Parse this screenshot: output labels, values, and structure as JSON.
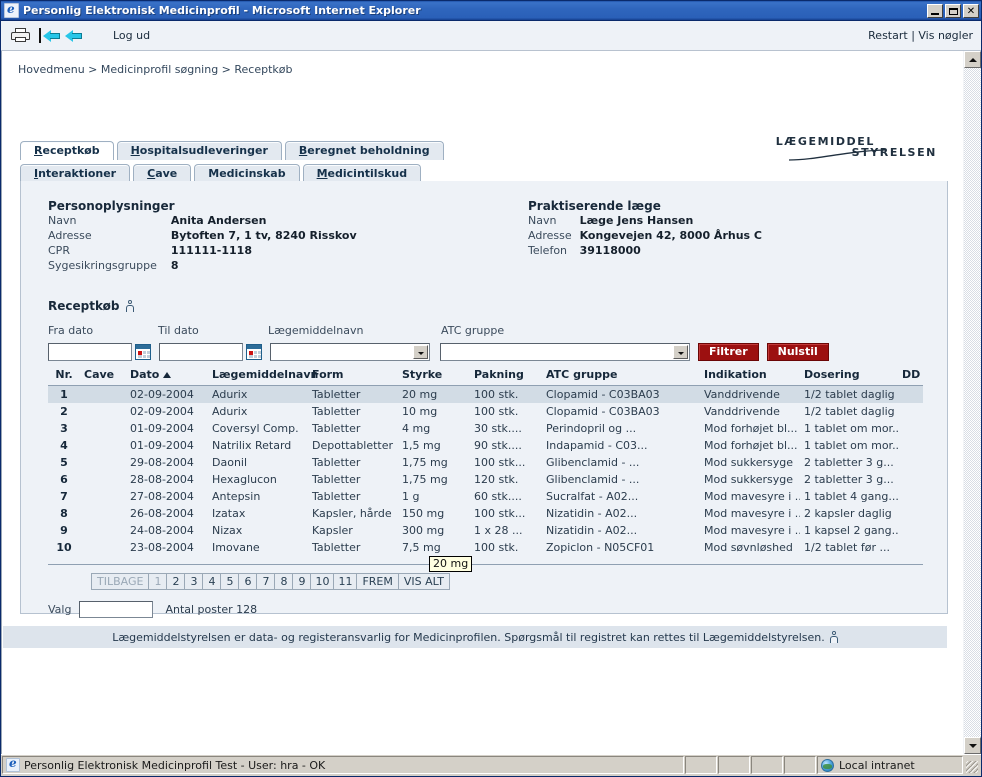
{
  "window": {
    "title": "Personlig Elektronisk Medicinprofil - Microsoft Internet Explorer",
    "icon": "ie-icon",
    "minimize_label": "",
    "maximize_label": "",
    "close_label": "✕"
  },
  "toolbar": {
    "print_icon": "printer-icon",
    "back_icon": "back-arrow-icon",
    "forward_icon": "second-back-arrow-icon",
    "logout_label": "Log ud",
    "right_links": "Restart | Vis nøgler"
  },
  "breadcrumb": "Hovedmenu > Medicinprofil søgning > Receptkøb",
  "logo": {
    "line1": "LÆGEMIDDEL",
    "line2": "STYRELSEN"
  },
  "tabs": {
    "row1": [
      {
        "label": "Receptkøb",
        "accesskey": "R",
        "active": true
      },
      {
        "label": "Hospitalsudleveringer",
        "accesskey": "H",
        "active": false
      },
      {
        "label": "Beregnet beholdning",
        "accesskey": "B",
        "active": false
      }
    ],
    "row2": [
      {
        "label": "Interaktioner",
        "accesskey": "I",
        "active": false
      },
      {
        "label": "Cave",
        "accesskey": "C",
        "active": false
      },
      {
        "label": "Medicinskab",
        "accesskey": "",
        "active": false
      },
      {
        "label": "Medicintilskud",
        "accesskey": "M",
        "active": false
      }
    ]
  },
  "person": {
    "heading": "Personoplysninger",
    "rows": [
      {
        "label": "Navn",
        "value": "Anita Andersen"
      },
      {
        "label": "Adresse",
        "value": "Bytoften 7, 1 tv, 8240 Risskov"
      },
      {
        "label": "CPR",
        "value": "111111-1118"
      },
      {
        "label": "Sygesikringsgruppe",
        "value": "8"
      }
    ]
  },
  "doctor": {
    "heading": "Praktiserende læge",
    "rows": [
      {
        "label": "Navn",
        "value": "Læge Jens Hansen"
      },
      {
        "label": "Adresse",
        "value": "Kongevejen 42, 8000 Århus C"
      },
      {
        "label": "Telefon",
        "value": "39118000"
      }
    ]
  },
  "section": {
    "title": "Receptkøb",
    "help_icon": "help-info-icon"
  },
  "filters": {
    "from_date": {
      "label": "Fra dato",
      "value": "",
      "calendar_icon": "calendar-icon"
    },
    "to_date": {
      "label": "Til dato",
      "value": "",
      "calendar_icon": "calendar-icon"
    },
    "drug_name": {
      "label": "Lægemiddelnavn",
      "value": "",
      "dropdown_icon": "chevron-down-icon"
    },
    "atc_group": {
      "label": "ATC gruppe",
      "value": "",
      "dropdown_icon": "chevron-down-icon"
    },
    "filter_button": "Filtrer",
    "reset_button": "Nulstil",
    "button_color": "#9c1010"
  },
  "table": {
    "columns": [
      "Nr.",
      "Cave",
      "Dato",
      "Lægemiddelnavn",
      "Form",
      "Styrke",
      "Pakning",
      "ATC gruppe",
      "Indikation",
      "Dosering",
      "DD"
    ],
    "sort_column": "Dato",
    "sort_direction": "asc",
    "sort_icon": "sort-ascending-icon",
    "selected_row_index": 0,
    "rows": [
      {
        "nr": "1",
        "cave": "",
        "dato": "02-09-2004",
        "navn": "Adurix",
        "form": "Tabletter",
        "styrke": "20 mg",
        "pakning": "100 stk.",
        "atc": "Clopamid - C03BA03",
        "indikation": "Vanddrivende",
        "dosering": "1/2 tablet daglig",
        "dd": ""
      },
      {
        "nr": "2",
        "cave": "",
        "dato": "02-09-2004",
        "navn": "Adurix",
        "form": "Tabletter",
        "styrke": "10 mg",
        "pakning": "100 stk.",
        "atc": "Clopamid - C03BA03",
        "indikation": "Vanddrivende",
        "dosering": "1/2 tablet daglig",
        "dd": ""
      },
      {
        "nr": "3",
        "cave": "",
        "dato": "01-09-2004",
        "navn": "Coversyl Comp.",
        "form": "Tabletter",
        "styrke": "4 mg",
        "pakning": "30 stk....",
        "atc": "Perindopril og ...",
        "indikation": "Mod forhøjet bl...",
        "dosering": "1 tablet om mor...",
        "dd": ""
      },
      {
        "nr": "4",
        "cave": "",
        "dato": "01-09-2004",
        "navn": "Natrilix Retard",
        "form": "Depottabletter",
        "styrke": "1,5 mg",
        "pakning": "90 stk....",
        "atc": "Indapamid - C03...",
        "indikation": "Mod forhøjet bl...",
        "dosering": "1 tablet om mor...",
        "dd": ""
      },
      {
        "nr": "5",
        "cave": "",
        "dato": "29-08-2004",
        "navn": "Daonil",
        "form": "Tabletter",
        "styrke": "1,75 mg",
        "pakning": "100 stk...",
        "atc": "Glibenclamid - ...",
        "indikation": "Mod sukkersyge",
        "dosering": "2 tabletter 3 g...",
        "dd": ""
      },
      {
        "nr": "6",
        "cave": "",
        "dato": "28-08-2004",
        "navn": "Hexaglucon",
        "form": "Tabletter",
        "styrke": "1,75 mg",
        "pakning": "120 stk.",
        "atc": "Glibenclamid - ...",
        "indikation": "Mod sukkersyge",
        "dosering": "2 tabletter 3 g...",
        "dd": ""
      },
      {
        "nr": "7",
        "cave": "",
        "dato": "27-08-2004",
        "navn": "Antepsin",
        "form": "Tabletter",
        "styrke": "1 g",
        "pakning": "60 stk....",
        "atc": "Sucralfat - A02...",
        "indikation": "Mod mavesyre i ...",
        "dosering": "1 tablet 4 gang...",
        "dd": ""
      },
      {
        "nr": "8",
        "cave": "",
        "dato": "26-08-2004",
        "navn": "Izatax",
        "form": "Kapsler, hårde",
        "styrke": "150 mg",
        "pakning": "100 stk...",
        "atc": "Nizatidin - A02...",
        "indikation": "Mod mavesyre i ...",
        "dosering": "2 kapsler daglig",
        "dd": ""
      },
      {
        "nr": "9",
        "cave": "",
        "dato": "24-08-2004",
        "navn": "Nizax",
        "form": "Kapsler",
        "styrke": "300 mg",
        "pakning": "1 x 28 ...",
        "atc": "Nizatidin - A02...",
        "indikation": "Mod mavesyre i ...",
        "dosering": "1 kapsel 2 gang...",
        "dd": ""
      },
      {
        "nr": "10",
        "cave": "",
        "dato": "23-08-2004",
        "navn": "Imovane",
        "form": "Tabletter",
        "styrke": "7,5 mg",
        "pakning": "100 stk.",
        "atc": "Zopiclon - N05CF01",
        "indikation": "Mod søvnløshed",
        "dosering": "1/2 tablet før ...",
        "dd": ""
      }
    ]
  },
  "tooltip": {
    "text": "20 mg"
  },
  "pager": {
    "prev": "TILBAGE",
    "pages": [
      "1",
      "2",
      "3",
      "4",
      "5",
      "6",
      "7",
      "8",
      "9",
      "10",
      "11"
    ],
    "current_page": "1",
    "next": "FREM",
    "show_all": "VIS ALT"
  },
  "selection": {
    "label": "Valg",
    "value": "",
    "count_label": "Antal poster 128"
  },
  "footer": {
    "text": "Lægemiddelstyrelsen er data- og registeransvarlig for Medicinprofilen. Spørgsmål til registret kan rettes til Lægemiddelstyrelsen.",
    "help_icon": "help-info-icon"
  },
  "statusbar": {
    "text": "Personlig Elektronisk Medicinprofil Test - User: hra - OK",
    "zone": "Local intranet",
    "zone_icon": "globe-icon"
  }
}
